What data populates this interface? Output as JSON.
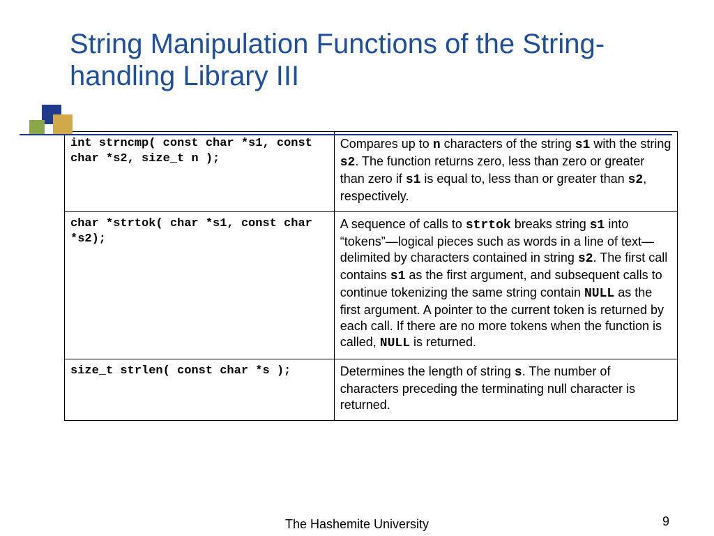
{
  "title": "String Manipulation Functions of the String-handling Library III",
  "rows": [
    {
      "signature": "int strncmp( const char *s1, const char *s2, size_t n );",
      "description": " Compares up to <b>n</b> characters of the string <b>s1</b> with the string <b>s2</b>. The function returns zero, less than zero or greater than zero if <b>s1</b> is equal to, less than or greater than <b>s2</b>, respectively."
    },
    {
      "signature": "char *strtok( char *s1, const char *s2);",
      "description": " A sequence of calls to <b>strtok</b> breaks string <b>s1</b> into “tokens”—logical pieces such as words in a line of text—delimited by characters contained in string <b>s2</b>. The first call contains <b>s1</b> as the first argument, and subsequent calls to continue tokenizing the same string contain <b>NULL</b> as the first argument. A pointer to the current token is returned by each call. If there are no more tokens when the function is called, <b>NULL</b> is returned."
    },
    {
      "signature": "size_t strlen( const char *s );",
      "description": " Determines the length of string <b>s</b>. The number of characters preceding the terminating null character is returned."
    }
  ],
  "footer": "The Hashemite University",
  "page_number": "9"
}
